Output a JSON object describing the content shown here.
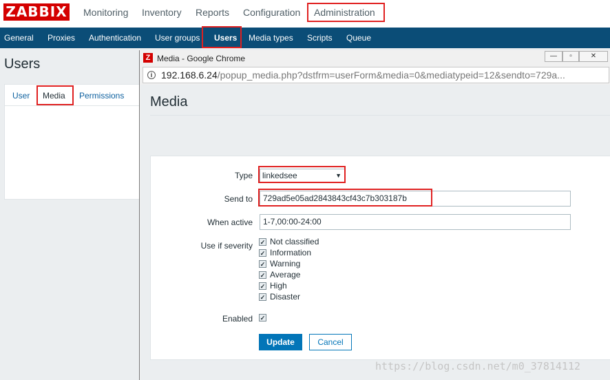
{
  "app": {
    "logo": "ZABBIX"
  },
  "main_menu": [
    "Monitoring",
    "Inventory",
    "Reports",
    "Configuration",
    "Administration"
  ],
  "sub_menu": [
    "General",
    "Proxies",
    "Authentication",
    "User groups",
    "Users",
    "Media types",
    "Scripts",
    "Queue"
  ],
  "page": {
    "title": "Users",
    "tabs": [
      "User",
      "Media",
      "Permissions"
    ]
  },
  "popup": {
    "window_title": "Media - Google Chrome",
    "url_host": "192.168.6.24",
    "url_path": "/popup_media.php?dstfrm=userForm&media=0&mediatypeid=12&sendto=729a...",
    "title": "Media",
    "form": {
      "type_label": "Type",
      "type_value": "linkedsee",
      "sendto_label": "Send to",
      "sendto_value": "729ad5e05ad2843843cf43c7b303187b",
      "active_label": "When active",
      "active_value": "1-7,00:00-24:00",
      "severity_label": "Use if severity",
      "severities": [
        "Not classified",
        "Information",
        "Warning",
        "Average",
        "High",
        "Disaster"
      ],
      "enabled_label": "Enabled",
      "update_button": "Update",
      "cancel_button": "Cancel"
    }
  },
  "watermark": "https://blog.csdn.net/m0_37814112",
  "colors": {
    "accent": "#0275b8",
    "brand": "#d40000",
    "nav": "#0b4d77",
    "highlight": "#e02020"
  }
}
